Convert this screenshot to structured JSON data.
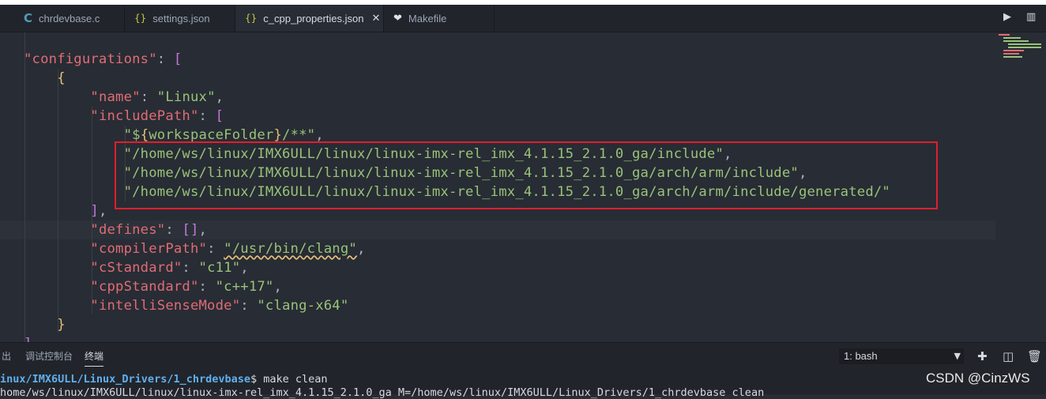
{
  "tabs": [
    {
      "label": "chrdevbase.c",
      "icon": "c-file-icon",
      "glyph": "C"
    },
    {
      "label": "settings.json",
      "icon": "json-file-icon",
      "glyph": "{}"
    },
    {
      "label": "c_cpp_properties.json",
      "icon": "json-file-icon",
      "glyph": "{}",
      "active": true
    },
    {
      "label": "Makefile",
      "icon": "makefile-icon",
      "glyph": "❤"
    }
  ],
  "tab_close_glyph": "✕",
  "toolbar": {
    "run_glyph": "▶",
    "split_glyph": "▥"
  },
  "code": {
    "configurations_key": "\"configurations\"",
    "name_key": "\"name\"",
    "name_val": "\"Linux\"",
    "include_key": "\"includePath\"",
    "include_0_prefix": "\"$",
    "include_0_var": "workspaceFolder",
    "include_0_suffix": "/**\"",
    "include_1": "\"/home/ws/linux/IMX6ULL/linux/linux-imx-rel_imx_4.1.15_2.1.0_ga/include\"",
    "include_2": "\"/home/ws/linux/IMX6ULL/linux/linux-imx-rel_imx_4.1.15_2.1.0_ga/arch/arm/include\"",
    "include_3": "\"/home/ws/linux/IMX6ULL/linux/linux-imx-rel_imx_4.1.15_2.1.0_ga/arch/arm/include/generated/\"",
    "defines_key": "\"defines\"",
    "compiler_key": "\"compilerPath\"",
    "compiler_val": "\"/usr/bin/clang\"",
    "cstd_key": "\"cStandard\"",
    "cstd_val": "\"c11\"",
    "cppstd_key": "\"cppStandard\"",
    "cppstd_val": "\"c++17\"",
    "intelli_key": "\"intelliSenseMode\"",
    "intelli_val": "\"clang-x64\""
  },
  "panel": {
    "tab_output": "出",
    "tab_debug": "调试控制台",
    "tab_terminal": "终端",
    "terminal_select": "1: bash",
    "line1_path": "inux/IMX6ULL/Linux_Drivers/1_chrdevbase",
    "line1_cmd": "$ make clean",
    "line2": "home/ws/linux/IMX6ULL/linux/linux-imx-rel_imx_4.1.15_2.1.0_ga M=/home/ws/linux/IMX6ULL/Linux_Drivers/1_chrdevbase clean"
  },
  "watermark": "CSDN @CinzWS",
  "colors": {
    "key": "#e06c75",
    "string": "#98c379",
    "bracket": "#c678dd",
    "brace": "#e5c07b",
    "highlight_box": "#e01e2e"
  }
}
